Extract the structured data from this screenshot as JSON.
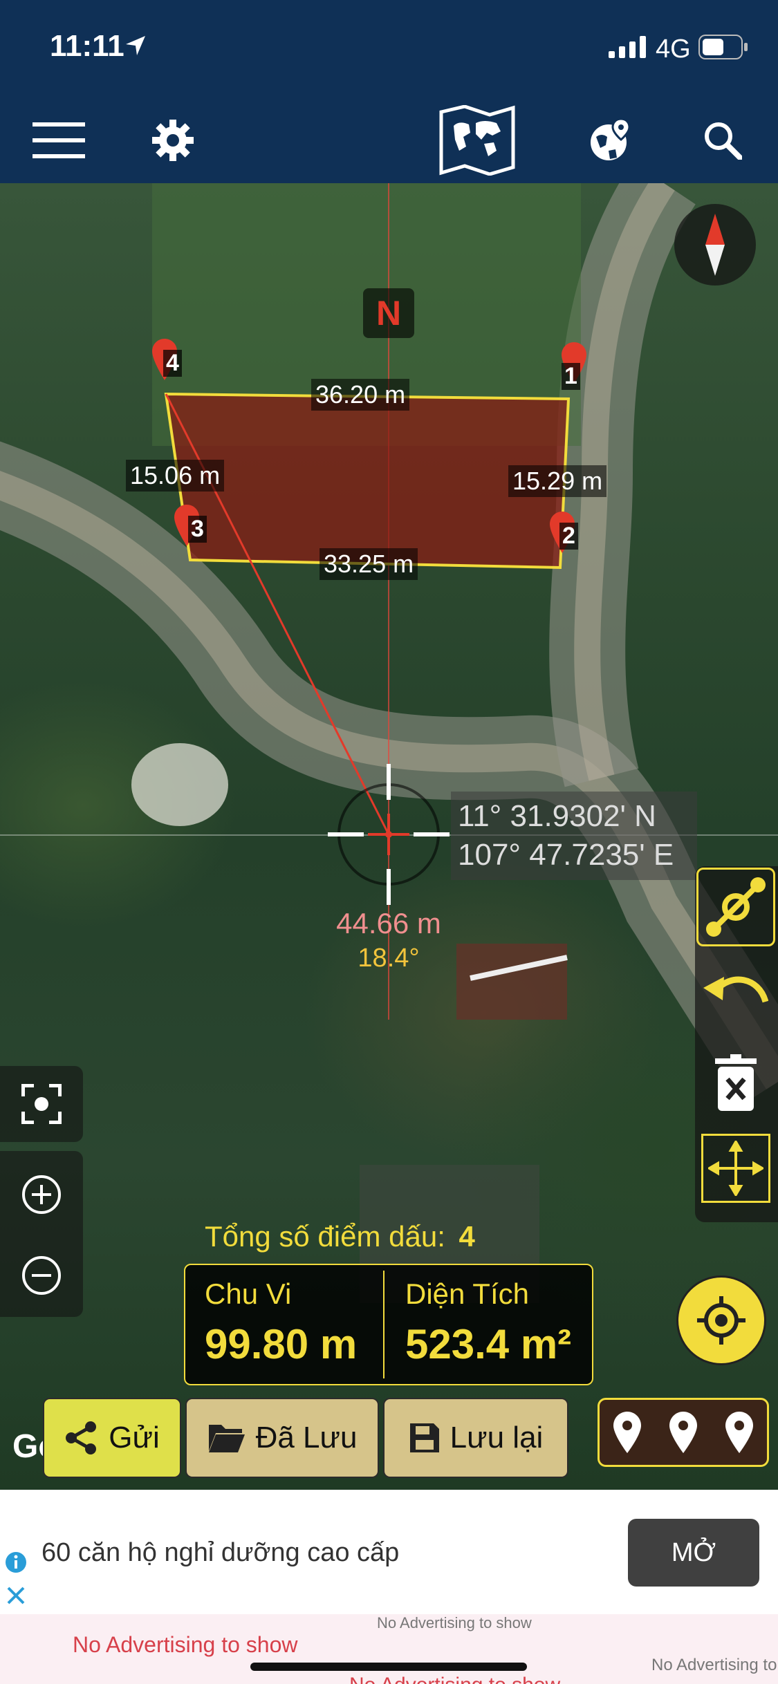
{
  "status": {
    "time": "11:11",
    "network": "4G"
  },
  "header": {
    "menu_icon": "hamburger-menu-icon",
    "settings_icon": "gear-icon",
    "map_icon": "world-map-icon",
    "globe_icon": "globe-pin-icon",
    "search_icon": "search-icon"
  },
  "map": {
    "north_label": "N",
    "markers": [
      "1",
      "2",
      "3",
      "4"
    ],
    "distances": {
      "top": "36.20 m",
      "right": "15.29 m",
      "bottom": "33.25 m",
      "left": "15.06 m"
    },
    "coords": {
      "lat": "11° 31.9302' N",
      "lon": "107° 47.7235' E"
    },
    "cursor_distance": "44.66 m",
    "cursor_angle": "18.4°",
    "google_logo": "Google"
  },
  "summary": {
    "points_label": "Tổng số điểm dấu:",
    "points_value": "4",
    "perimeter_label": "Chu Vi",
    "perimeter_value": "99.80 m",
    "area_label": "Diện Tích",
    "area_value": "523.4 m²"
  },
  "buttons": {
    "send": "Gửi",
    "saved": "Đã Lưu",
    "save": "Lưu lại"
  },
  "ad": {
    "text": "60 căn hộ nghỉ dưỡng cao cấp",
    "cta": "MỞ",
    "no_ads_1": "No Advertising to show",
    "no_ads_2": "No Advertising to show",
    "no_ads_3": "No Advertising to show",
    "no_ads_4": "No Advertising to show"
  },
  "colors": {
    "header_bg": "#0f3056",
    "accent_yellow": "#f2dc3c",
    "polygon_fill": "#8b1c14",
    "button_tan": "#d6c48a",
    "send_button": "#dfe04a"
  }
}
